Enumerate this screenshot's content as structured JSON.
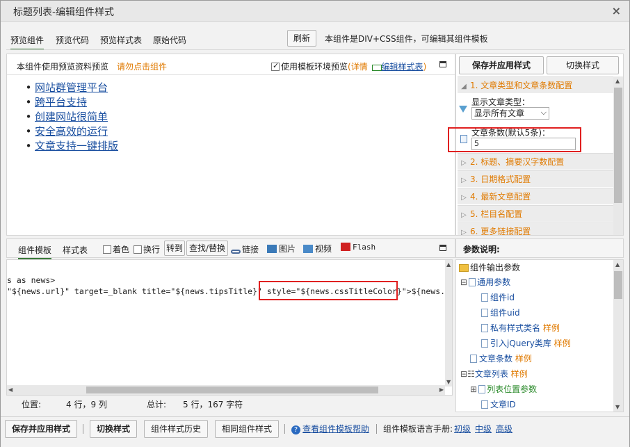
{
  "window": {
    "title": "标题列表-编辑组件样式",
    "close": "×"
  },
  "top_tabs": [
    "预览组件",
    "预览代码",
    "预览样式表",
    "原始代码"
  ],
  "refresh_label": "刷新",
  "component_note": "本组件是DIV+CSS组件，可编辑其组件模板",
  "preview": {
    "hint": "本组件使用预览资料预览",
    "hint_warn": "请勿点击组件",
    "use_template_env": "使用模板环境预览",
    "detail_open": "(",
    "detail": "详情",
    "edit_stylesheet": "编辑样式表",
    "detail_close": ")",
    "items": [
      "网站群管理平台",
      "跨平台支持",
      "创建网站很简单",
      "安全高效的运行",
      "文章支持一键排版"
    ]
  },
  "right_panel": {
    "save_apply": "保存并应用样式",
    "switch_style": "切换样式",
    "sections": [
      "1. 文章类型和文章条数配置",
      "2. 标题、摘要汉字数配置",
      "3. 日期格式配置",
      "4. 最新文章配置",
      "5. 栏目名配置",
      "6. 更多链接配置"
    ],
    "article_type_label": "显示文章类型：",
    "article_type_value": "显示所有文章",
    "article_count_label": "文章条数(默认5条)：",
    "article_count_value": "5"
  },
  "editor": {
    "tab_template": "组件模板",
    "tab_stylesheet": "样式表",
    "color": "着色",
    "wrap": "换行",
    "goto": "转到",
    "find_replace": "查找/替换",
    "link": "链接",
    "image": "图片",
    "video": "视频",
    "flash": "Flash",
    "line1": "s as news>",
    "line2a": "\"${news.url}\" target=_blank title=\"${news.tipsTitle}\" ",
    "line2b": "style=\"${news.cssTitleColor}\"",
    "line2c": ">${news.sho"
  },
  "status": {
    "pos_label": "位置:",
    "pos_value": "4 行，9 列",
    "total_label": "总计:",
    "total_value": "5 行，167 字符"
  },
  "params": {
    "title": "参数说明:",
    "root": "组件输出参数",
    "general": "通用参数",
    "component_id": "组件id",
    "component_uid": "组件uid",
    "private_class": "私有样式类名",
    "jquery": "引入jQuery类库",
    "example": "样例",
    "article_count": "文章条数",
    "article_list": "文章列表",
    "list_position": "列表位置参数",
    "article_id": "文章ID"
  },
  "bottom": {
    "save_apply": "保存并应用样式",
    "switch_style": "切换样式",
    "history": "组件样式历史",
    "same": "相同组件样式",
    "help": "查看组件模板帮助",
    "manual": "组件模板语言手册:",
    "basic": "初级",
    "mid": "中级",
    "adv": "高级"
  },
  "colors": {
    "accent": "#e07a00",
    "link": "#1a4fa0",
    "highlight": "#e02020"
  }
}
